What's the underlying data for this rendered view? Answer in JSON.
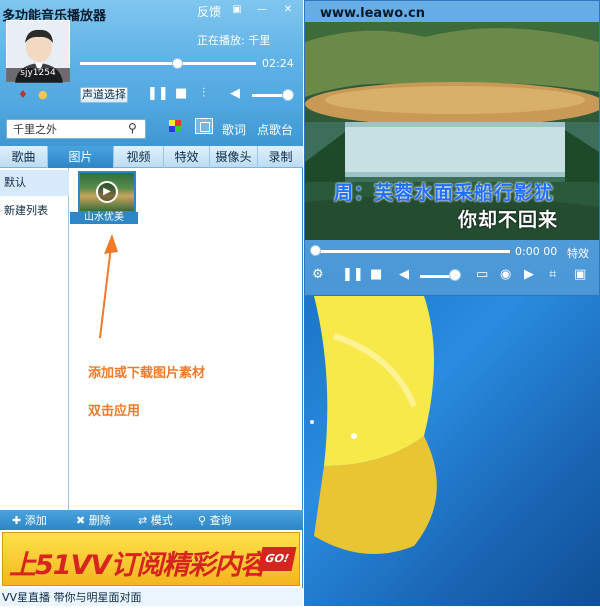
{
  "app": {
    "title": "多功能音乐播放器",
    "feedback_label": "反馈"
  },
  "user": {
    "name": "sjy1254"
  },
  "now_playing": {
    "text": "正在播放: 千里",
    "time": "02:24",
    "progress": 0.55
  },
  "controls": {
    "channel_label": "声道选择",
    "volume": 0.8
  },
  "search": {
    "placeholder": "千里之外"
  },
  "header_links": {
    "lyrics": "歌词",
    "song_request": "点歌台"
  },
  "tabs": [
    {
      "label": "歌曲"
    },
    {
      "label": "图片"
    },
    {
      "label": "视频"
    },
    {
      "label": "特效"
    },
    {
      "label": "摄像头"
    },
    {
      "label": "录制"
    }
  ],
  "lists": [
    {
      "label": "默认"
    },
    {
      "label": "新建列表"
    }
  ],
  "thumbnail": {
    "label": "山水优美"
  },
  "hints": {
    "line1": "添加或下载图片素材",
    "line2": "双击应用"
  },
  "toolbar": {
    "add": "添加",
    "delete": "删除",
    "mode": "模式",
    "query": "查询"
  },
  "banner": {
    "text": "上51VV订阅精彩内容",
    "go": "GO!"
  },
  "footer": {
    "text": "VV星直播  带你与明星面对面"
  },
  "video": {
    "watermark": "www.leawo.cn",
    "lyric_line1": "周：芙蓉水面采船行影犹",
    "lyric_line2": "你却不回来",
    "time": "0:00 00",
    "effects_label": "特效"
  },
  "colors": {
    "accent": "#2d86c6",
    "hint": "#f07a2a",
    "lyric_blue": "#1f70ff"
  }
}
